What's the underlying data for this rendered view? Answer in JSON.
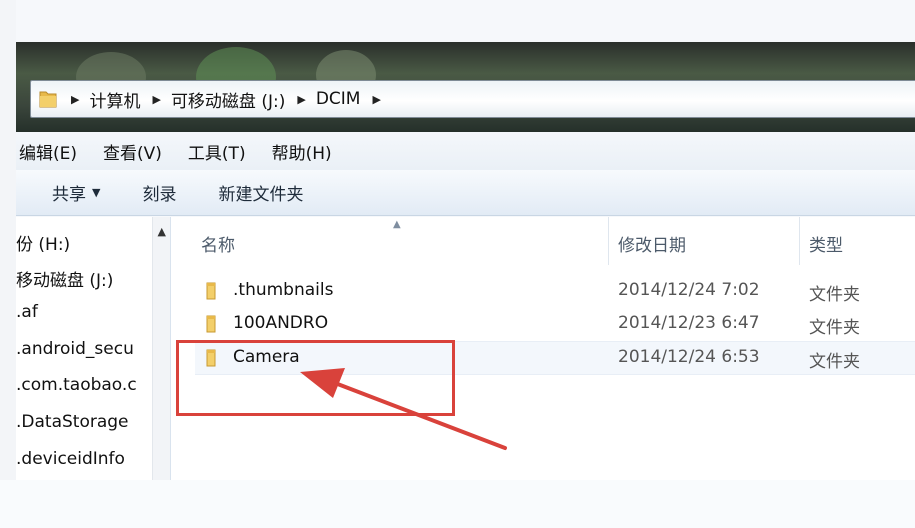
{
  "address": {
    "crumbs": [
      "计算机",
      "可移动磁盘 (J:)",
      "DCIM"
    ]
  },
  "menu": {
    "items": [
      "编辑(E)",
      "查看(V)",
      "工具(T)",
      "帮助(H)"
    ]
  },
  "toolbar": {
    "share": "共享",
    "burn": "刻录",
    "new_folder": "新建文件夹"
  },
  "navpane": {
    "items": [
      "份 (H:)",
      "移动磁盘 (J:)",
      ".af",
      ".android_secu",
      ".com.taobao.c",
      ".DataStorage",
      ".deviceidInfo"
    ]
  },
  "columns": {
    "name": "名称",
    "modified": "修改日期",
    "type": "类型"
  },
  "files": [
    {
      "name": ".thumbnails",
      "date": "2014/12/24 7:02",
      "type": "文件夹"
    },
    {
      "name": "100ANDRO",
      "date": "2014/12/23 6:47",
      "type": "文件夹"
    },
    {
      "name": "Camera",
      "date": "2014/12/24 6:53",
      "type": "文件夹"
    }
  ],
  "annotation": {
    "color": "#d9423b"
  },
  "colors": {
    "folder": "#e8b94a",
    "accent": "#d9423b"
  }
}
